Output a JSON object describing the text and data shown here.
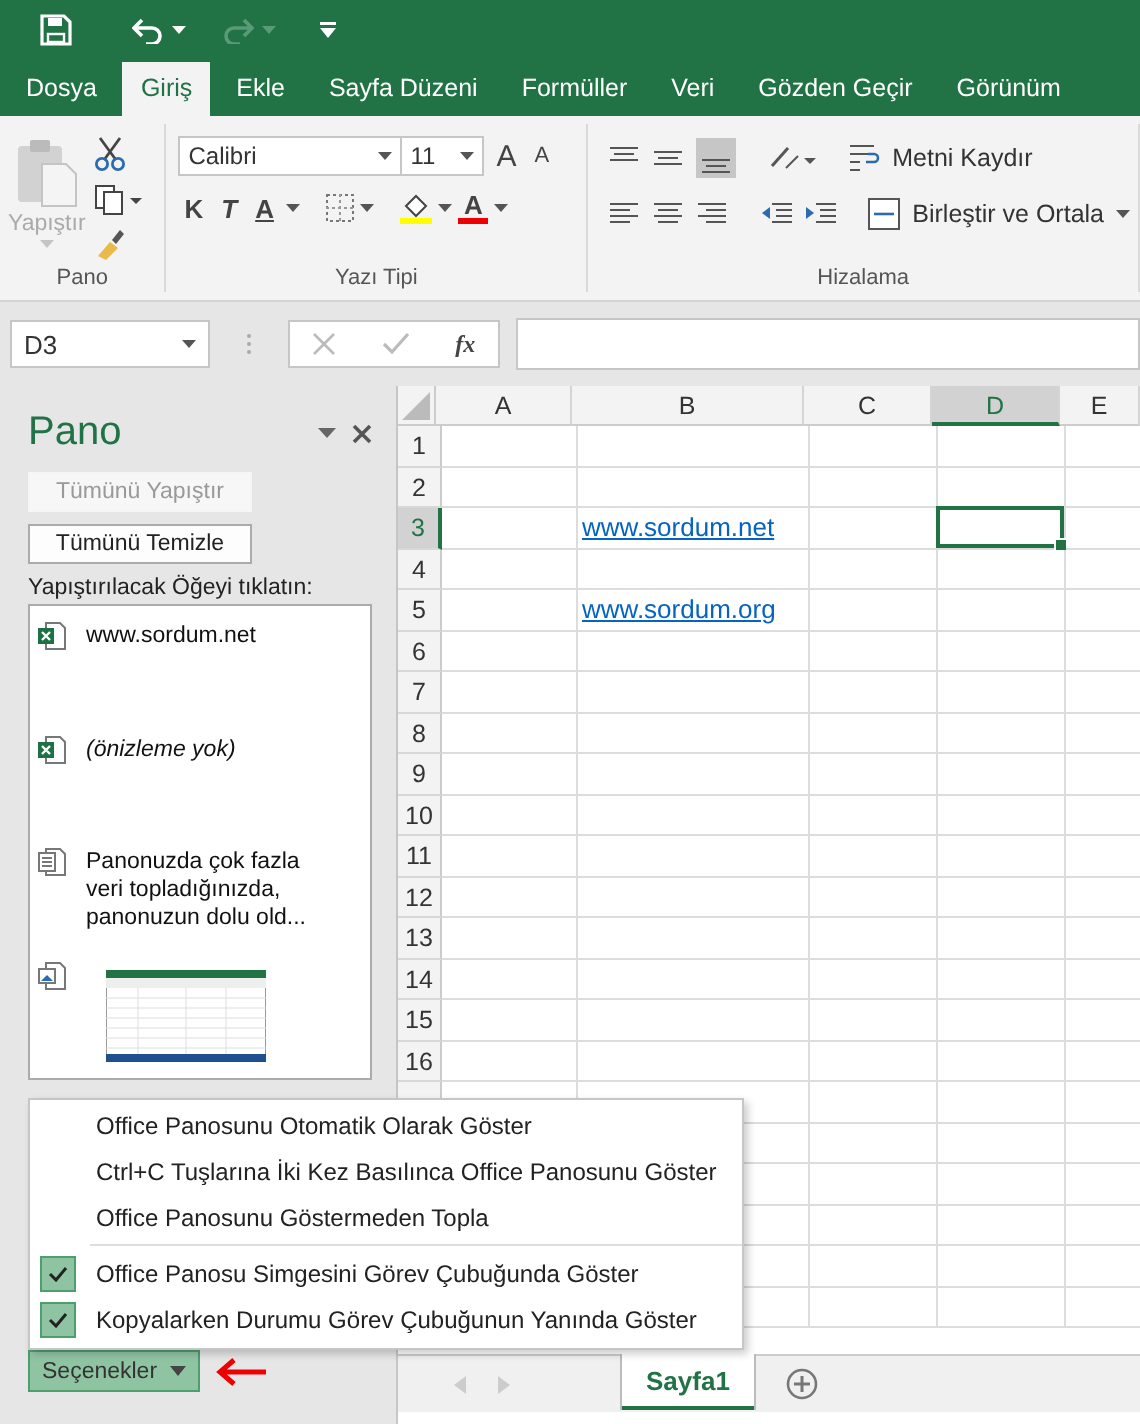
{
  "ribbon_tabs": [
    {
      "label": "Dosya",
      "selected": false
    },
    {
      "label": "Giriş",
      "selected": true
    },
    {
      "label": "Ekle",
      "selected": false
    },
    {
      "label": "Sayfa Düzeni",
      "selected": false
    },
    {
      "label": "Formüller",
      "selected": false
    },
    {
      "label": "Veri",
      "selected": false
    },
    {
      "label": "Gözden Geçir",
      "selected": false
    },
    {
      "label": "Görünüm",
      "selected": false
    }
  ],
  "ribbon": {
    "paste_label": "Yapıştır",
    "font_name": "Calibri",
    "font_size": "11",
    "grow_font": "A",
    "shrink_font": "A",
    "bold": "K",
    "italic": "T",
    "underline": "A",
    "font_color": "A",
    "wrap_text": "Metni Kaydır",
    "merge_center": "Birleştir ve Ortala",
    "groups": [
      "Pano",
      "Yazı Tipi",
      "Hizalama"
    ]
  },
  "formula_bar": {
    "name_box": "D3",
    "function_symbol": "fx"
  },
  "clipboard_pane": {
    "title": "Pano",
    "buttons": [
      {
        "label": "Tümünü Yapıştır",
        "disabled": true
      },
      {
        "label": "Tümünü Temizle",
        "disabled": false
      }
    ],
    "instruction": "Yapıştırılacak Öğeyi tıklatın:",
    "items": [
      {
        "kind": "excel",
        "text": "www.sordum.net"
      },
      {
        "kind": "excel-preview",
        "text": "(önizleme yok)"
      },
      {
        "kind": "text",
        "text": "Panonuzda çok fazla\nveri topladığınızda,\npanonuzun dolu old..."
      },
      {
        "kind": "image"
      }
    ],
    "options_button": "Seçenekler"
  },
  "grid": {
    "columns": [
      {
        "label": "A",
        "selected": false
      },
      {
        "label": "B",
        "selected": false
      },
      {
        "label": "C",
        "selected": false
      },
      {
        "label": "D",
        "selected": true
      },
      {
        "label": "E",
        "selected": false
      }
    ],
    "rows": [
      {
        "label": "1",
        "selected": false
      },
      {
        "label": "2",
        "selected": false
      },
      {
        "label": "3",
        "selected": true,
        "link": "www.sordum.net"
      },
      {
        "label": "4",
        "selected": false
      },
      {
        "label": "5",
        "selected": false,
        "link": "www.sordum.org"
      },
      {
        "label": "6",
        "selected": false
      },
      {
        "label": "7",
        "selected": false
      },
      {
        "label": "8",
        "selected": false
      },
      {
        "label": "9",
        "selected": false
      },
      {
        "label": "10",
        "selected": false
      },
      {
        "label": "11",
        "selected": false
      },
      {
        "label": "12",
        "selected": false
      },
      {
        "label": "13",
        "selected": false
      },
      {
        "label": "14",
        "selected": false
      },
      {
        "label": "15",
        "selected": false
      },
      {
        "label": "16",
        "selected": false
      }
    ]
  },
  "options_menu": {
    "sections": [
      {
        "items": [
          {
            "label": "Office Panosunu Otomatik Olarak Göster",
            "checked": false
          },
          {
            "label": "Ctrl+C Tuşlarına İki Kez Basılınca Office Panosunu Göster",
            "checked": false
          },
          {
            "label": "Office Panosunu Göstermeden Topla",
            "checked": false
          }
        ]
      },
      {
        "items": [
          {
            "label": "Office Panosu Simgesini Görev Çubuğunda Göster",
            "checked": true
          },
          {
            "label": "Kopyalarken Durumu Görev Çubuğunun Yanında Göster",
            "checked": true
          }
        ]
      }
    ]
  },
  "sheet_tabs": [
    {
      "label": "Sayfa1",
      "selected": true
    }
  ]
}
